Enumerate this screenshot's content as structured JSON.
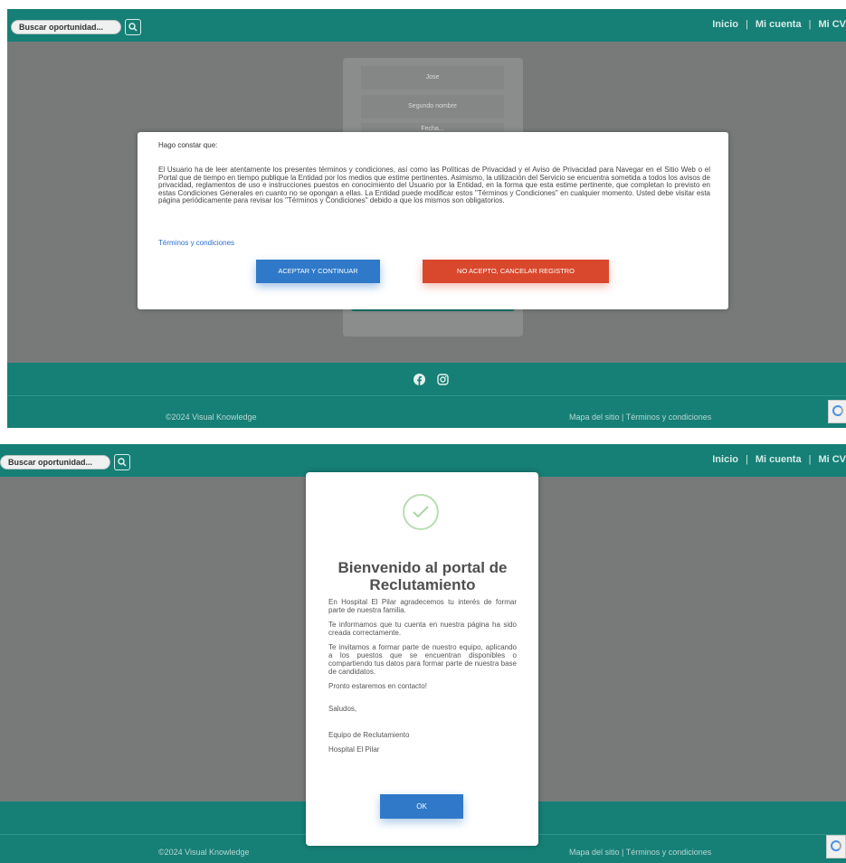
{
  "header": {
    "search_placeholder": "Buscar oportunidad...",
    "nav": [
      "Inicio",
      "Mi cuenta",
      "Mi CV"
    ],
    "nav_separator": "|"
  },
  "footer": {
    "copyright": "©2024 Visual Knowledge",
    "links": "Mapa del sitio | Términos y condiciones"
  },
  "form": {
    "first_name_value": "Jose",
    "second_name_placeholder": "Segundo nombre",
    "partial_field": "Fecha..."
  },
  "terms_modal": {
    "heading": "Hago constar que:",
    "body": "El Usuario ha de leer atentamente los presentes términos y condiciones, así como las Políticas de Privacidad y el Aviso de Privacidad para Navegar en el Sitio Web o el Portal que de tiempo en tiempo publique la Entidad por los medios que estime pertinentes. Asimismo, la utilización del Servicio se encuentra sometida a todos los avisos de privacidad, reglamentos de uso e instrucciones puestos en conocimiento del Usuario por la Entidad, en la forma que esta estime pertinente, que completan lo previsto en estas Condiciones Generales en cuanto no se opongan a ellas. La Entidad puede modificar estos \"Términos y Condiciones\" en cualquier momento. Usted debe visitar esta página periódicamente para revisar los \"Términos y Condiciones\" debido a que los mismos son obligatorios.",
    "link": "Términos y condiciones",
    "accept": "ACEPTAR Y CONTINUAR",
    "reject": "NO ACEPTO, CANCELAR REGISTRO"
  },
  "welcome_modal": {
    "title": "Bienvenido al portal de Reclutamiento",
    "paragraphs": [
      "En Hospital El Pilar agradecemos tu interés de formar parte de nuestra familia.",
      "Te informamos que tu cuenta en nuestra página ha sido creada correctamente.",
      "Te invitamos a formar parte de nuestro equipo, aplicando a los puestos que se encuentran disponibles o compartiendo tus datos para formar parte de nuestra base de candidatos.",
      "Pronto estaremos en contacto!",
      "Saludos,",
      "Equipo de Reclutamiento",
      "Hospital El Pilar"
    ],
    "ok": "OK"
  },
  "colors": {
    "teal": "#167f76",
    "accept_blue": "#2f79c8",
    "reject_red": "#d9482d"
  },
  "icons": [
    "search-icon",
    "facebook-icon",
    "instagram-icon",
    "check-icon",
    "recaptcha-icon"
  ]
}
